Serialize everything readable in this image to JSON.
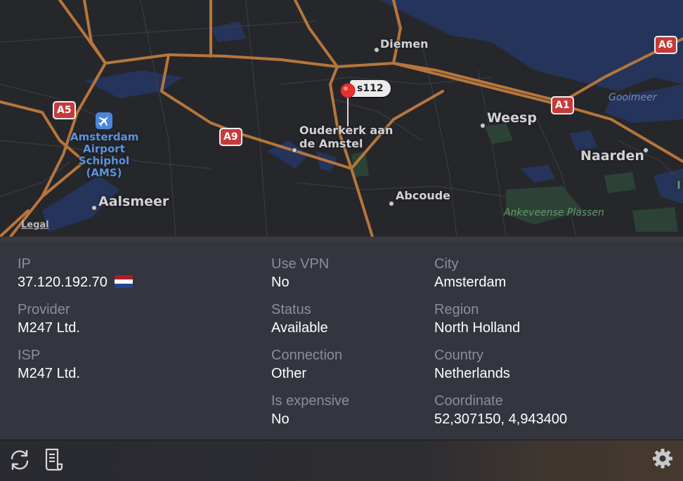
{
  "map": {
    "legal": "Legal",
    "pin_label": "s112",
    "places": {
      "diemen": "Diemen",
      "weesp": "Weesp",
      "naarden": "Naarden",
      "ouderkerk": "Ouderkerk aan\nde Amstel",
      "abcoude": "Abcoude",
      "aalsmeer": "Aalsmeer",
      "airport": "Amsterdam\nAirport\nSchiphol\n(AMS)",
      "gooimeer": "Gooimeer",
      "ankeveense": "Ankeveense Plassen",
      "edge": "I"
    },
    "shields": {
      "a5": "A5",
      "a9": "A9",
      "a1": "A1",
      "a6": "A6"
    },
    "icons": {
      "pin": "map-pin-icon",
      "airport": "airplane-icon"
    }
  },
  "info": {
    "ip_label": "IP",
    "ip_value": "37.120.192.70",
    "provider_label": "Provider",
    "provider_value": "M247 Ltd.",
    "isp_label": "ISP",
    "isp_value": "M247 Ltd.",
    "vpn_label": "Use VPN",
    "vpn_value": "No",
    "status_label": "Status",
    "status_value": "Available",
    "connection_label": "Connection",
    "connection_value": "Other",
    "expensive_label": "Is expensive",
    "expensive_value": "No",
    "city_label": "City",
    "city_value": "Amsterdam",
    "region_label": "Region",
    "region_value": "North Holland",
    "country_label": "Country",
    "country_value": "Netherlands",
    "coord_label": "Coordinate",
    "coord_value": "52,307150, 4,943400",
    "flag_colors": [
      "#ae1c28",
      "#ffffff",
      "#21468b"
    ]
  },
  "footer": {
    "icons": [
      "refresh-icon",
      "log-icon",
      "gear-icon"
    ]
  },
  "colors": {
    "map_bg": "#26272b",
    "water": "#25345a",
    "road": "#b6763c",
    "shield": "#c73a3a",
    "panel_bg": "#33353f"
  }
}
